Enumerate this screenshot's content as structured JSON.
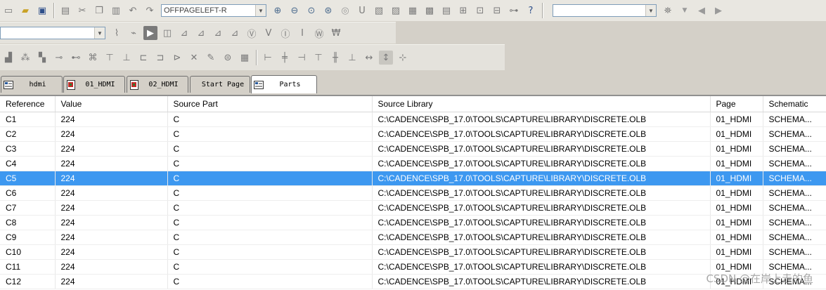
{
  "toolbar": {
    "page_combo_value": "OFFPAGELEFT-R",
    "search_combo_value": "",
    "filter_combo_value": ""
  },
  "tabs": [
    {
      "label": "hdmi",
      "icon": "schematic-page-icon"
    },
    {
      "label": "01_HDMI",
      "icon": "pdf-page-icon"
    },
    {
      "label": "02_HDMI",
      "icon": "pdf-page-icon"
    },
    {
      "label": "Start Page",
      "icon": ""
    },
    {
      "label": "Parts",
      "icon": "parts-list-icon"
    }
  ],
  "parts_table": {
    "columns": [
      "Reference",
      "Value",
      "Source Part",
      "Source Library",
      "Page",
      "Schematic"
    ],
    "rows": [
      [
        "C1",
        "224",
        "C",
        "C:\\CADENCE\\SPB_17.0\\TOOLS\\CAPTURE\\LIBRARY\\DISCRETE.OLB",
        "01_HDMI",
        "SCHEMA..."
      ],
      [
        "C2",
        "224",
        "C",
        "C:\\CADENCE\\SPB_17.0\\TOOLS\\CAPTURE\\LIBRARY\\DISCRETE.OLB",
        "01_HDMI",
        "SCHEMA..."
      ],
      [
        "C3",
        "224",
        "C",
        "C:\\CADENCE\\SPB_17.0\\TOOLS\\CAPTURE\\LIBRARY\\DISCRETE.OLB",
        "01_HDMI",
        "SCHEMA..."
      ],
      [
        "C4",
        "224",
        "C",
        "C:\\CADENCE\\SPB_17.0\\TOOLS\\CAPTURE\\LIBRARY\\DISCRETE.OLB",
        "01_HDMI",
        "SCHEMA..."
      ],
      [
        "C5",
        "224",
        "C",
        "C:\\CADENCE\\SPB_17.0\\TOOLS\\CAPTURE\\LIBRARY\\DISCRETE.OLB",
        "01_HDMI",
        "SCHEMA..."
      ],
      [
        "C6",
        "224",
        "C",
        "C:\\CADENCE\\SPB_17.0\\TOOLS\\CAPTURE\\LIBRARY\\DISCRETE.OLB",
        "01_HDMI",
        "SCHEMA..."
      ],
      [
        "C7",
        "224",
        "C",
        "C:\\CADENCE\\SPB_17.0\\TOOLS\\CAPTURE\\LIBRARY\\DISCRETE.OLB",
        "01_HDMI",
        "SCHEMA..."
      ],
      [
        "C8",
        "224",
        "C",
        "C:\\CADENCE\\SPB_17.0\\TOOLS\\CAPTURE\\LIBRARY\\DISCRETE.OLB",
        "01_HDMI",
        "SCHEMA..."
      ],
      [
        "C9",
        "224",
        "C",
        "C:\\CADENCE\\SPB_17.0\\TOOLS\\CAPTURE\\LIBRARY\\DISCRETE.OLB",
        "01_HDMI",
        "SCHEMA..."
      ],
      [
        "C10",
        "224",
        "C",
        "C:\\CADENCE\\SPB_17.0\\TOOLS\\CAPTURE\\LIBRARY\\DISCRETE.OLB",
        "01_HDMI",
        "SCHEMA..."
      ],
      [
        "C11",
        "224",
        "C",
        "C:\\CADENCE\\SPB_17.0\\TOOLS\\CAPTURE\\LIBRARY\\DISCRETE.OLB",
        "01_HDMI",
        "SCHEMA..."
      ],
      [
        "C12",
        "224",
        "C",
        "C:\\CADENCE\\SPB_17.0\\TOOLS\\CAPTURE\\LIBRARY\\DISCRETE.OLB",
        "01_HDMI",
        "SCHEMA..."
      ]
    ],
    "selected_row": 4
  },
  "watermark": "CSDN @在岸上走的鱼",
  "colors": {
    "selection": "#3d98f0",
    "toolbar_bg": "#e4e2dc"
  }
}
